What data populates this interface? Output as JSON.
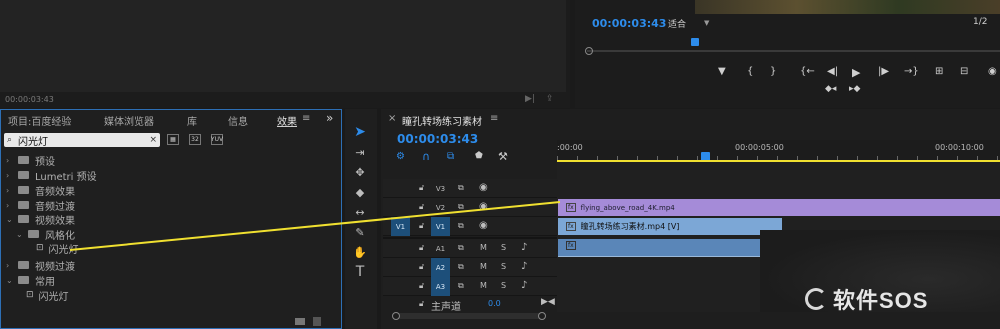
{
  "source_monitor": {
    "timecode": "00:00:03:43"
  },
  "program_monitor": {
    "timecode": "00:00:03:43",
    "fit_label": "适合",
    "quality": "1/2",
    "transport_buttons": [
      "▼",
      "{",
      "}",
      "{←",
      "◀|",
      "▶",
      "|▶",
      "→}",
      "⊞",
      "⊟",
      "◉"
    ],
    "extra_buttons": [
      "◆◂",
      "▸◆"
    ]
  },
  "project_panel": {
    "tabs": [
      "项目:百度经验",
      "媒体浏览器",
      "库",
      "信息",
      "效果"
    ],
    "tab_menu": "≡",
    "overflow": "»",
    "search_value": "闪光灯",
    "tree": [
      {
        "label": "预设",
        "depth": 0,
        "expanded": false,
        "type": "folder"
      },
      {
        "label": "Lumetri 预设",
        "depth": 0,
        "expanded": false,
        "type": "folder"
      },
      {
        "label": "音频效果",
        "depth": 0,
        "expanded": false,
        "type": "folder"
      },
      {
        "label": "音频过渡",
        "depth": 0,
        "expanded": false,
        "type": "folder"
      },
      {
        "label": "视频效果",
        "depth": 0,
        "expanded": true,
        "type": "folder"
      },
      {
        "label": "风格化",
        "depth": 1,
        "expanded": true,
        "type": "folder"
      },
      {
        "label": "闪光灯",
        "depth": 2,
        "expanded": false,
        "type": "effect"
      },
      {
        "label": "视频过渡",
        "depth": 0,
        "expanded": false,
        "type": "folder"
      },
      {
        "label": "常用",
        "depth": 0,
        "expanded": true,
        "type": "folder"
      },
      {
        "label": "闪光灯",
        "depth": 1,
        "expanded": false,
        "type": "effect"
      }
    ]
  },
  "timeline": {
    "close": "×",
    "sequence_name": "瞳孔转场练习素材",
    "menu": "≡",
    "timecode": "00:00:03:43",
    "ruler": [
      ":00:00",
      "00:00:05:00",
      "00:00:10:00"
    ],
    "video_tracks": [
      {
        "name": "V3",
        "source": ""
      },
      {
        "name": "V2",
        "source": ""
      },
      {
        "name": "V1",
        "source": "V1"
      }
    ],
    "audio_tracks": [
      {
        "name": "A1",
        "source": "",
        "m": "M",
        "s": "S"
      },
      {
        "name": "A2",
        "source": "A2",
        "m": "M",
        "s": "S"
      },
      {
        "name": "A3",
        "source": "A3",
        "m": "M",
        "s": "S"
      }
    ],
    "master": {
      "label": "主声道",
      "value": "0.0"
    },
    "clips": {
      "v2": "flying_above_road_4K.mp4",
      "v1": "瞳孔转场练习素材.mp4 [V]"
    }
  },
  "watermark": {
    "text": "软件SOS"
  },
  "colors": {
    "timecode": "#2d8ceb",
    "clip_v2": "#a58bd8",
    "clip_v1": "#7ca7d6",
    "clip_a1": "#5a86b8",
    "annotation_line": "#f0e030"
  }
}
